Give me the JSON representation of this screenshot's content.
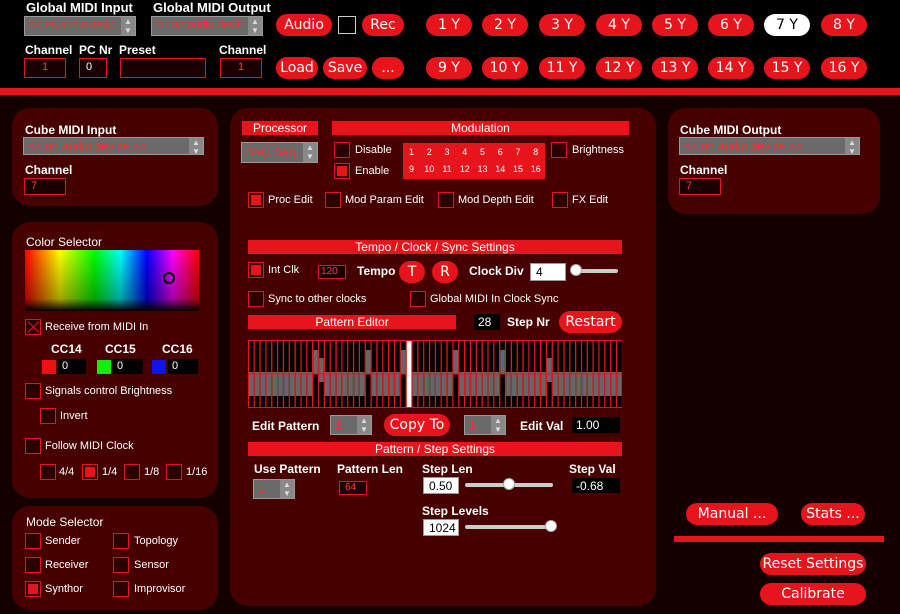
{
  "global": {
    "midi_input_label": "Global MIDI Input",
    "midi_input_value": "<< no audio devic...",
    "midi_output_label": "Global MIDI Output",
    "midi_output_value": "<< no audio devic...",
    "channel_label": "Channel",
    "channel_value": "1",
    "pc_label": "PC Nr",
    "pc_value": "0",
    "preset_label": "Preset",
    "preset_value": "",
    "channel2_label": "Channel",
    "channel2_value": "1"
  },
  "buttons": {
    "audio": "Audio",
    "rec": "Rec",
    "load": "Load",
    "save": "Save",
    "more": "..."
  },
  "slots": [
    "1 Y",
    "2 Y",
    "3 Y",
    "4 Y",
    "5 Y",
    "6 Y",
    "7 Y",
    "8 Y",
    "9 Y",
    "10 Y",
    "11 Y",
    "12 Y",
    "13 Y",
    "14 Y",
    "15 Y",
    "16 Y"
  ],
  "selected_slot": "7 Y",
  "cube_in": {
    "label": "Cube MIDI Input",
    "device": "<< no audio device >>",
    "channel_label": "Channel",
    "channel": "7"
  },
  "cube_out": {
    "label": "Cube MIDI Output",
    "device": "<< no audio device >>",
    "channel_label": "Channel",
    "channel": "7"
  },
  "color": {
    "label": "Color Selector",
    "receive": "Receive from MIDI In",
    "cc14": "CC14",
    "cc15": "CC15",
    "cc16": "CC16",
    "v14": "0",
    "v15": "0",
    "v16": "0",
    "signals": "Signals control Brightness",
    "invert": "Invert",
    "follow": "Follow MIDI Clock",
    "div1": "4/4",
    "div2": "1/4",
    "div3": "1/8",
    "div4": "1/16"
  },
  "mode": {
    "label": "Mode Selector",
    "sender": "Sender",
    "topology": "Topology",
    "receiver": "Receiver",
    "sensor": "Sensor",
    "synthor": "Synthor",
    "improvisor": "Improvisor"
  },
  "processor": {
    "label": "Processor",
    "value": "Step Seq"
  },
  "modulation": {
    "label": "Modulation",
    "disable": "Disable",
    "enable": "Enable",
    "brightness": "Brightness",
    "cells": [
      "1",
      "2",
      "3",
      "4",
      "5",
      "6",
      "7",
      "8",
      "9",
      "10",
      "11",
      "12",
      "13",
      "14",
      "15",
      "16"
    ]
  },
  "edit": {
    "proc": "Proc Edit",
    "modparam": "Mod Param Edit",
    "moddepth": "Mod Depth Edit",
    "fx": "FX Edit"
  },
  "tempo": {
    "label": "Tempo / Clock / Sync Settings",
    "intclk": "Int Clk",
    "bpm": "120",
    "tempo": "Tempo",
    "t": "T",
    "r": "R",
    "clockdiv_label": "Clock Div",
    "clockdiv": "4",
    "sync": "Sync to other clocks",
    "global_sync": "Global MIDI In Clock Sync"
  },
  "pattern_editor": {
    "label": "Pattern Editor",
    "step_nr": "28",
    "step_nr_label": "Step Nr",
    "restart": "Restart",
    "edit_pattern_label": "Edit Pattern",
    "edit_pattern": "1",
    "copy_to": "Copy To",
    "copy_target": "1",
    "edit_val_label": "Edit Val",
    "edit_val": "1.00"
  },
  "pattern_settings": {
    "label": "Pattern / Step Settings",
    "use_pattern_label": "Use Pattern",
    "use_pattern": "1",
    "pattern_len_label": "Pattern Len",
    "pattern_len": "64",
    "step_len_label": "Step Len",
    "step_len": "0.50",
    "step_val_label": "Step Val",
    "step_val": "-0.68",
    "step_levels_label": "Step Levels",
    "step_levels": "1024"
  },
  "right": {
    "manual": "Manual ...",
    "stats": "Stats ...",
    "reset": "Reset Settings",
    "calibrate": "Calibrate"
  },
  "colors": {
    "accent": "#e8141c",
    "panel": "#470000",
    "bg": "#150000"
  }
}
